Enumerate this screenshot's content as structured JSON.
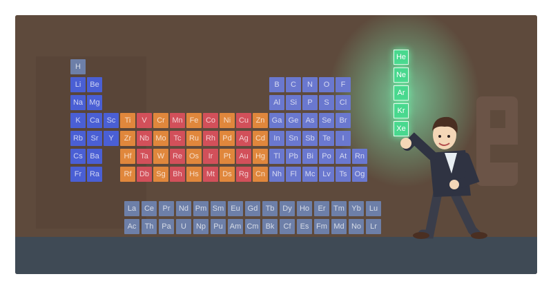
{
  "colors": {
    "background": "#5e4a3c",
    "floor": "#3f4a55",
    "s_block": "#4a5fd4",
    "d_block_red": "#d2505a",
    "d_block_orange": "#e0873c",
    "p_block": "#6a78cf",
    "f_block": "#6d7fa8",
    "noble_glow": "#49d88e",
    "letter_e": "#6b5447"
  },
  "main_table": {
    "rows": [
      [
        "H"
      ],
      [
        "Li",
        "Be",
        "B",
        "C",
        "N",
        "O",
        "F"
      ],
      [
        "Na",
        "Mg",
        "Al",
        "Si",
        "P",
        "S",
        "Cl"
      ],
      [
        "K",
        "Ca",
        "Sc",
        "Ti",
        "V",
        "Cr",
        "Mn",
        "Fe",
        "Co",
        "Ni",
        "Cu",
        "Zn",
        "Ga",
        "Ge",
        "As",
        "Se",
        "Br"
      ],
      [
        "Rb",
        "Sr",
        "Y",
        "Zr",
        "Nb",
        "Mo",
        "Tc",
        "Ru",
        "Rh",
        "Pd",
        "Ag",
        "Cd",
        "In",
        "Sn",
        "Sb",
        "Te",
        "I"
      ],
      [
        "Cs",
        "Ba",
        "",
        "Hf",
        "Ta",
        "W",
        "Re",
        "Os",
        "Ir",
        "Pt",
        "Au",
        "Hg",
        "Tl",
        "Pb",
        "Bi",
        "Po",
        "At",
        "Rn"
      ],
      [
        "Fr",
        "Ra",
        "",
        "Rf",
        "Db",
        "Sg",
        "Bh",
        "Hs",
        "Mt",
        "Ds",
        "Rg",
        "Cn",
        "Nh",
        "Fl",
        "Mc",
        "Lv",
        "Ts",
        "Og"
      ]
    ]
  },
  "f_block": {
    "rows": [
      [
        "La",
        "Ce",
        "Pr",
        "Nd",
        "Pm",
        "Sm",
        "Eu",
        "Gd",
        "Tb",
        "Dy",
        "Ho",
        "Er",
        "Tm",
        "Yb",
        "Lu"
      ],
      [
        "Ac",
        "Th",
        "Pa",
        "U",
        "Np",
        "Pu",
        "Am",
        "Cm",
        "Bk",
        "Cf",
        "Es",
        "Fm",
        "Md",
        "No",
        "Lr"
      ]
    ]
  },
  "noble_column": [
    "He",
    "Ne",
    "Ar",
    "Kr",
    "Xe"
  ],
  "figure": {
    "description_icon": "scientist-holding-noble-gases-icon"
  }
}
